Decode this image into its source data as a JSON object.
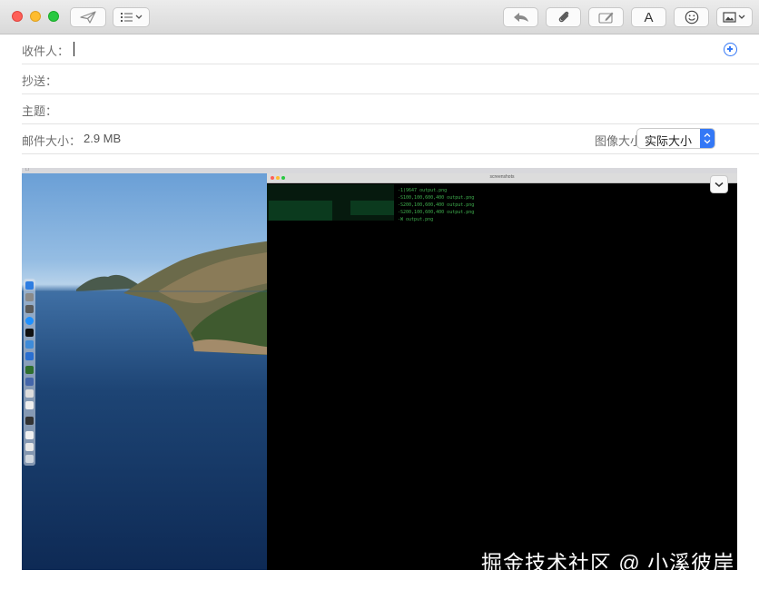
{
  "window": {
    "toolbar": {
      "buttons": [
        {
          "name": "send",
          "icon": "paper-plane-icon"
        },
        {
          "name": "header-fields",
          "icon": "list-chevron-icon"
        },
        {
          "name": "reply",
          "icon": "reply-arrow-icon"
        },
        {
          "name": "attach",
          "icon": "paperclip-icon"
        },
        {
          "name": "markup",
          "icon": "markup-pen-icon"
        },
        {
          "name": "format",
          "icon": "format-a-icon",
          "label": "A"
        },
        {
          "name": "emoji",
          "icon": "smiley-icon"
        },
        {
          "name": "photo-browser",
          "icon": "photo-chevron-icon"
        }
      ]
    }
  },
  "compose": {
    "to_label": "收件人：",
    "to_value": "",
    "cc_label": "抄送：",
    "cc_value": "",
    "subject_label": "主题：",
    "subject_value": "",
    "message_size_label": "邮件大小：",
    "message_size_value": "2.9 MB",
    "image_size_label": "图像大小：",
    "image_size_selected": "实际大小"
  },
  "attachment": {
    "terminal_lines": [
      "-1)9647 output.png",
      "-S100,100,600,400 output.png",
      "-S200,100,600,400 output.png",
      "-S200,100,600,400 output.png",
      "-W output.png"
    ],
    "terminal_title": "screenshots"
  },
  "watermark": "掘金技术社区 @ 小溪彼岸",
  "colors": {
    "accent": "#3478f6",
    "terminal_text": "#3fae4e",
    "label_text": "#6e6e6e"
  }
}
